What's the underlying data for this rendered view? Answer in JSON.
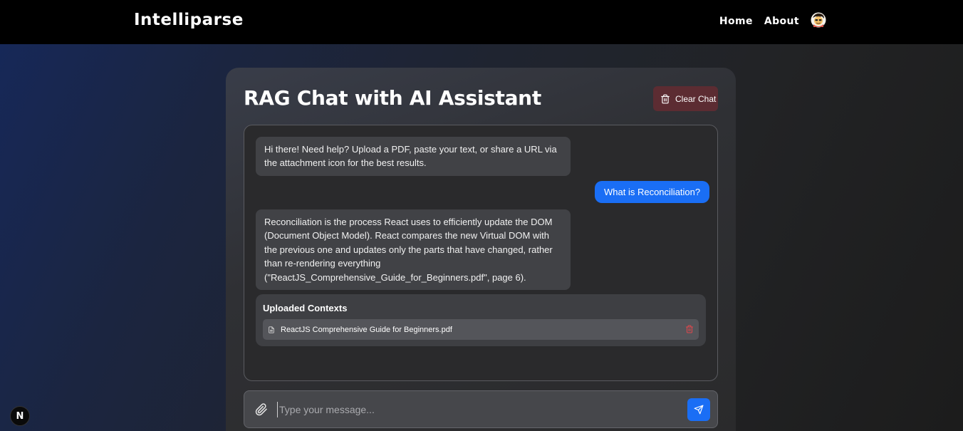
{
  "navbar": {
    "brand": "Intelliparse",
    "links": [
      "Home",
      "About"
    ],
    "avatar_icon": "user-avatar-icon"
  },
  "card": {
    "title": "RAG Chat with AI Assistant",
    "clear_label": "Clear Chat",
    "clear_icon": "trash-icon"
  },
  "messages": [
    {
      "role": "assistant",
      "text": "Hi there! Need help? Upload a PDF, paste your text, or share a URL via the attachment icon for the best results."
    },
    {
      "role": "user",
      "text": "What is Reconciliation?"
    },
    {
      "role": "assistant",
      "text": "Reconciliation is the process React uses to efficiently update the DOM (Document Object Model). React compares the new Virtual DOM with the previous one and updates only the parts that have changed, rather than re-rendering everything (\"ReactJS_Comprehensive_Guide_for_Beginners.pdf\", page 6)."
    }
  ],
  "contexts": {
    "title": "Uploaded Contexts",
    "files": [
      "ReactJS Comprehensive Guide for Beginners.pdf"
    ]
  },
  "input": {
    "placeholder": "Type your message...",
    "value": "",
    "attach_icon": "paperclip-icon",
    "send_icon": "send-icon"
  },
  "badge": {
    "letter": "N"
  },
  "colors": {
    "accent": "#1a6ef5",
    "clear_button": "#5c2c32",
    "delete_icon": "#e0474c",
    "navbar": "#000000"
  }
}
